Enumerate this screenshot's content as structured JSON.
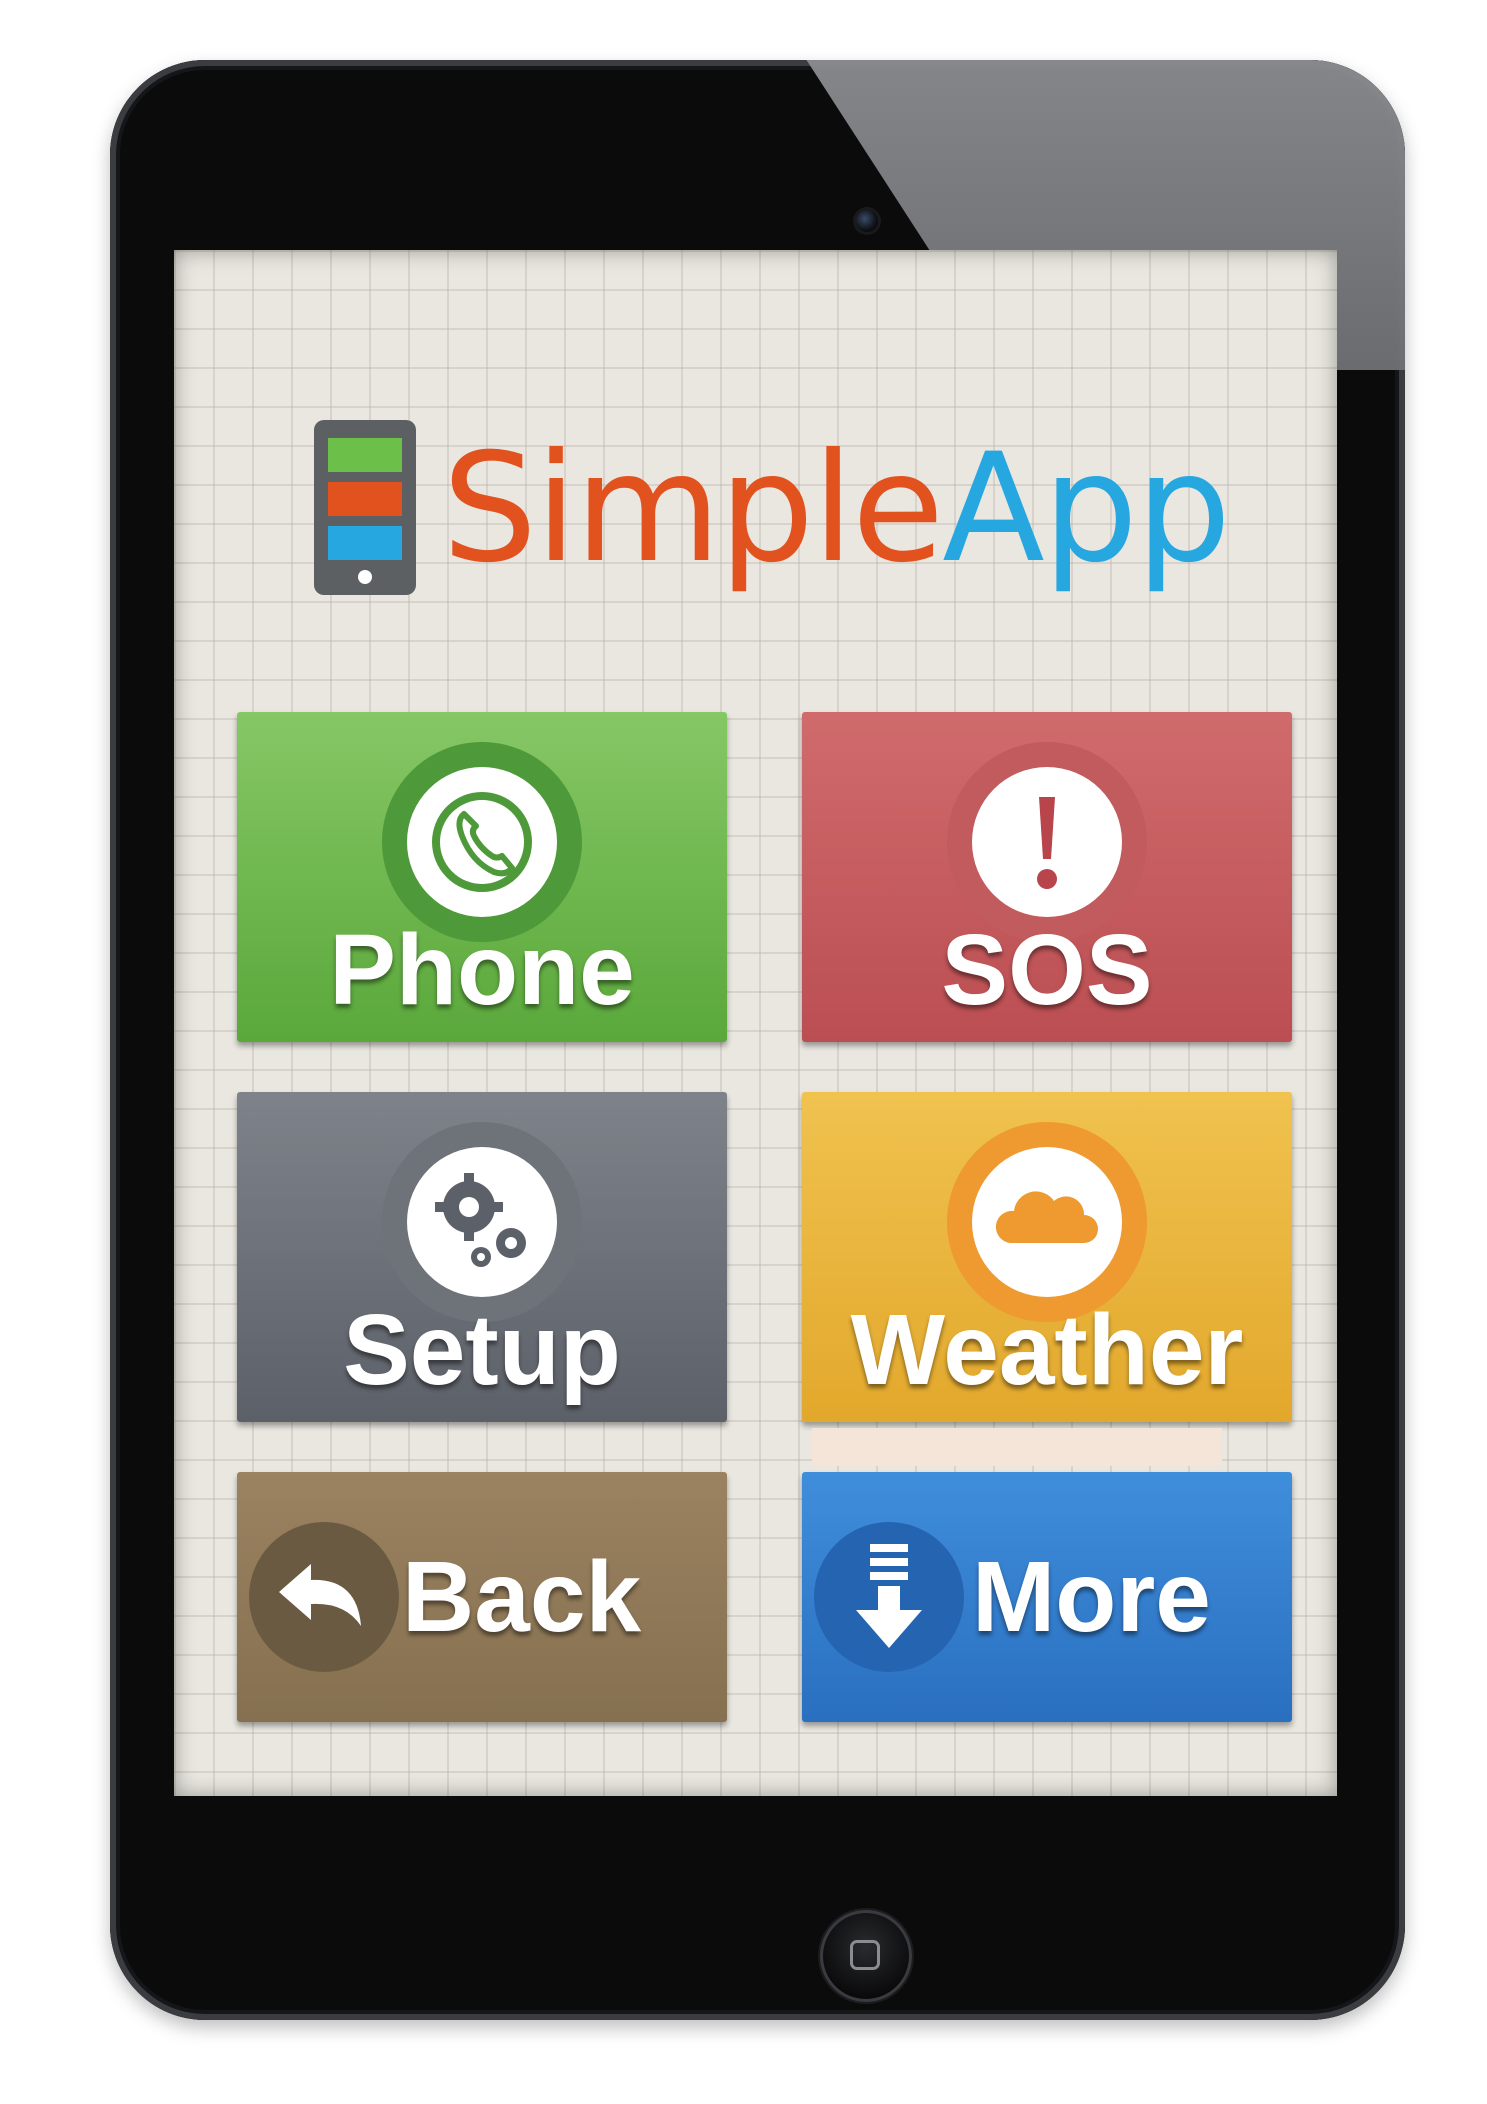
{
  "app": {
    "logo": {
      "part1": "Simple",
      "part2": "App"
    }
  },
  "tiles": [
    {
      "id": "phone",
      "label": "Phone",
      "icon": "phone-icon"
    },
    {
      "id": "sos",
      "label": "SOS",
      "icon": "exclamation-icon"
    },
    {
      "id": "setup",
      "label": "Setup",
      "icon": "gears-icon"
    },
    {
      "id": "weather",
      "label": "Weather",
      "icon": "cloud-icon"
    },
    {
      "id": "back",
      "label": "Back",
      "icon": "back-arrow-icon"
    },
    {
      "id": "more",
      "label": "More",
      "icon": "download-arrow-icon"
    }
  ],
  "colors": {
    "brand_orange": "#e2521f",
    "brand_blue": "#26a7e0",
    "phone_green": "#5aa83b",
    "sos_red": "#bb4e52",
    "setup_gray": "#5c6068",
    "weather_yellow": "#e2a82c",
    "back_brown": "#85704f",
    "more_blue": "#2a6fc0"
  }
}
